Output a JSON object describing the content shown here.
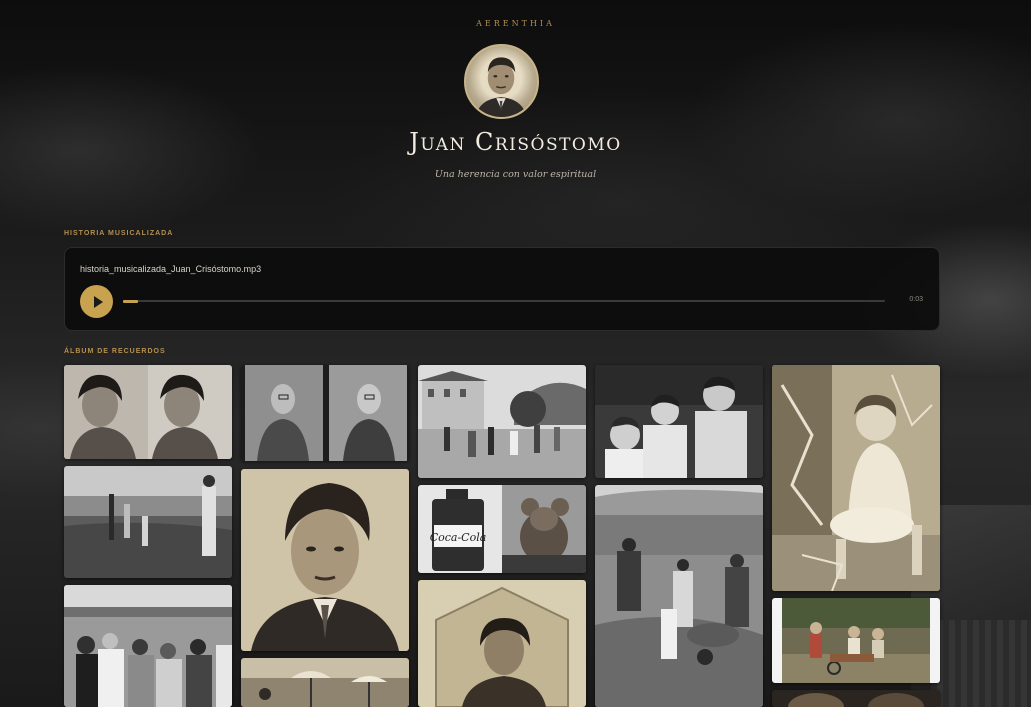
{
  "brand": "AERENTHIA",
  "profile": {
    "name": "Juan Crisóstomo",
    "tagline": "Una herencia con valor espiritual"
  },
  "music": {
    "section_label": "HISTORIA MUSICALIZADA",
    "file_name": "historia_musicalizada_Juan_Crisóstomo.mp3",
    "time": "0:03",
    "progress": 0.02
  },
  "album": {
    "section_label": "ÁLBUM DE RECUERDOS",
    "photos": [
      {
        "name": "photo-woman-portrait-pair",
        "tone": "bw"
      },
      {
        "name": "photo-men-portrait-pair",
        "tone": "bw"
      },
      {
        "name": "photo-village-street-dance",
        "tone": "bw"
      },
      {
        "name": "photo-three-boys",
        "tone": "bw"
      },
      {
        "name": "photo-girl-sitting-torn",
        "tone": "sepia"
      },
      {
        "name": "photo-beach-shoreline",
        "tone": "bw"
      },
      {
        "name": "photo-young-man-portrait",
        "tone": "sepia"
      },
      {
        "name": "photo-coca-cola-bottle-and-toy",
        "tone": "bw"
      },
      {
        "name": "photo-workers-with-wheelbarrow",
        "tone": "bw"
      },
      {
        "name": "photo-children-in-garden",
        "tone": "color"
      },
      {
        "name": "photo-crowd-at-harbor",
        "tone": "bw"
      },
      {
        "name": "photo-woman-in-frame",
        "tone": "sepia"
      },
      {
        "name": "photo-beach-umbrellas",
        "tone": "sepia"
      }
    ]
  }
}
